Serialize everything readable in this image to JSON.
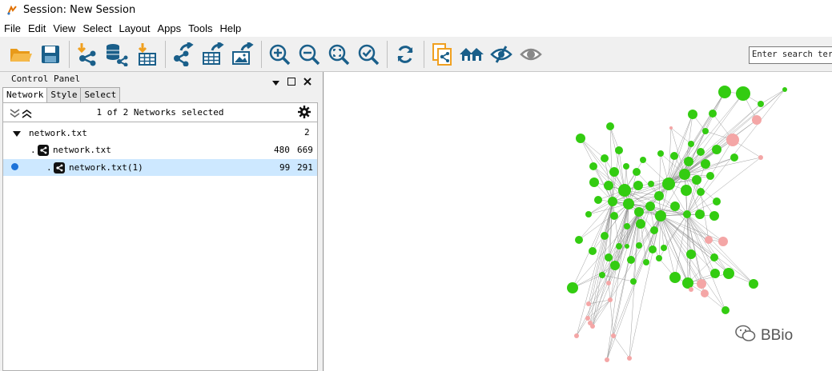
{
  "window": {
    "title": "Session: New Session"
  },
  "menu": [
    "File",
    "Edit",
    "View",
    "Select",
    "Layout",
    "Apps",
    "Tools",
    "Help"
  ],
  "toolbar": {
    "search_placeholder": "Enter search term",
    "icons": [
      "open-session-icon",
      "save-session-icon",
      "import-network-icon",
      "import-network-database-icon",
      "import-table-icon",
      "export-network-icon",
      "export-table-icon",
      "export-image-icon",
      "zoom-in-icon",
      "zoom-out-icon",
      "zoom-fit-icon",
      "zoom-selected-icon",
      "refresh-icon",
      "new-network-from-selection-icon",
      "home-icon",
      "hide-icon",
      "show-icon"
    ],
    "colors": {
      "orange": "#f0a020",
      "blue": "#1a5f8a"
    }
  },
  "control_panel": {
    "title": "Control Panel",
    "tabs": [
      "Network",
      "Style",
      "Select"
    ],
    "selected_count": "1 of 2 Networks selected",
    "tree": [
      {
        "label": "network.txt",
        "count1": "2",
        "count2": ""
      },
      {
        "label": "network.txt",
        "count1": "480",
        "count2": "669"
      },
      {
        "label": "network.txt(1)",
        "count1": "99",
        "count2": "291"
      }
    ]
  },
  "watermark": "BBio",
  "network_colors": {
    "green": "#33cc11",
    "pink": "#f4a6a6",
    "edge": "#888888"
  }
}
